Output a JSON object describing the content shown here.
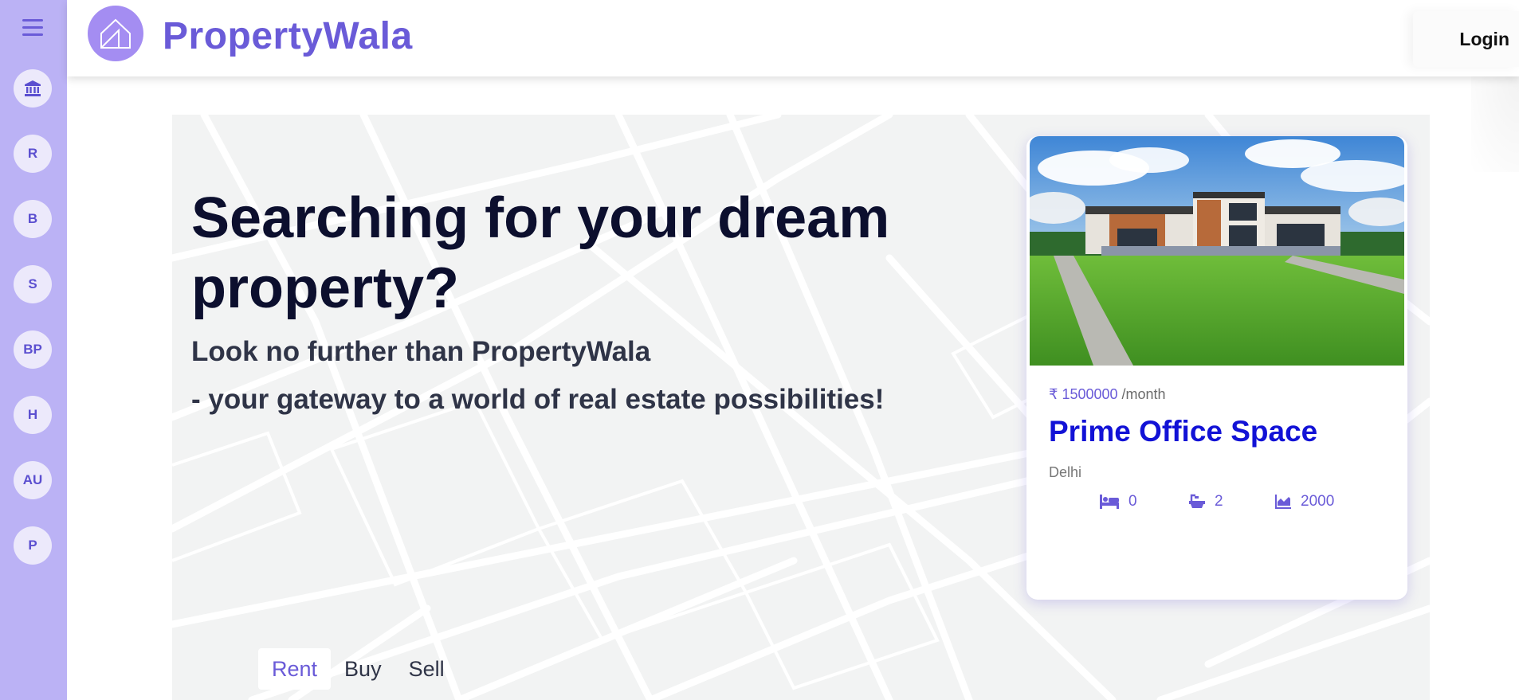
{
  "header": {
    "brand": "PropertyWala",
    "login_label": "Login"
  },
  "sidebar": {
    "items": [
      {
        "label": "",
        "icon": "bank-icon"
      },
      {
        "label": "R"
      },
      {
        "label": "B"
      },
      {
        "label": "S"
      },
      {
        "label": "BP"
      },
      {
        "label": "H"
      },
      {
        "label": "AU"
      },
      {
        "label": "P"
      }
    ]
  },
  "hero": {
    "headline": "Searching for your dream property?",
    "sub1": "Look no further than PropertyWala",
    "sub2": "- your gateway to a world of real estate possibilities!",
    "tabs": [
      {
        "label": "Rent",
        "active": true
      },
      {
        "label": "Buy",
        "active": false
      },
      {
        "label": "Sell",
        "active": false
      }
    ]
  },
  "card": {
    "price": "₹ 1500000",
    "per": " /month",
    "title": "Prime Office Space",
    "location": "Delhi",
    "beds": "0",
    "baths": "2",
    "area": "2000"
  },
  "colors": {
    "accent": "#6a5bd8",
    "sidebar": "#bbb2f5",
    "title": "#1212d6"
  }
}
